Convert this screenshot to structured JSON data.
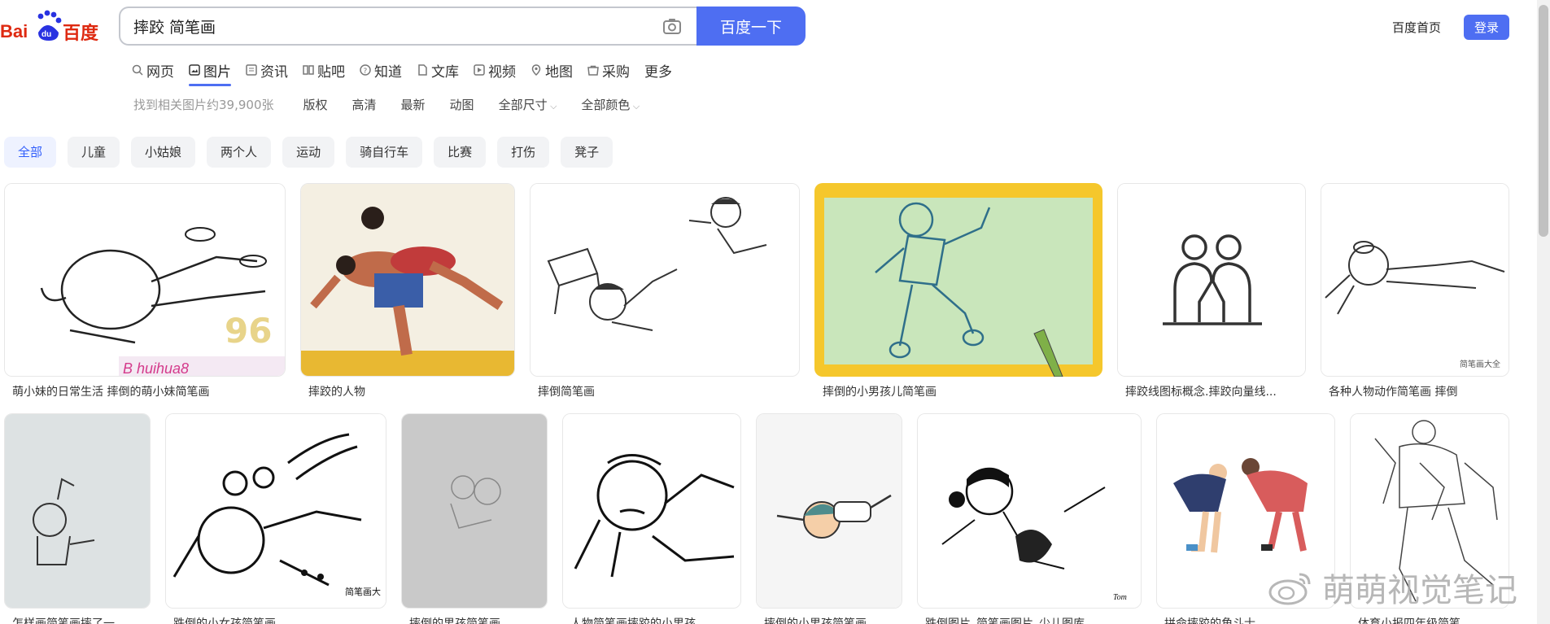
{
  "header": {
    "logo_text": "Bai du 百度",
    "search_value": "摔跤 简笔画",
    "search_button": "百度一下",
    "home_link": "百度首页",
    "login_button": "登录"
  },
  "tabs": [
    {
      "label": "网页",
      "icon": "search-icon"
    },
    {
      "label": "图片",
      "icon": "image-icon",
      "active": true
    },
    {
      "label": "资讯",
      "icon": "news-icon"
    },
    {
      "label": "贴吧",
      "icon": "tieba-icon"
    },
    {
      "label": "知道",
      "icon": "question-icon"
    },
    {
      "label": "文库",
      "icon": "doc-icon"
    },
    {
      "label": "视频",
      "icon": "video-icon"
    },
    {
      "label": "地图",
      "icon": "map-icon"
    },
    {
      "label": "采购",
      "icon": "shop-icon"
    },
    {
      "label": "更多",
      "icon": ""
    }
  ],
  "filters": {
    "result_count": "找到相关图片约39,900张",
    "items": [
      "版权",
      "高清",
      "最新",
      "动图",
      "全部尺寸",
      "全部颜色"
    ]
  },
  "chips": [
    "全部",
    "儿童",
    "小姑娘",
    "两个人",
    "运动",
    "骑自行车",
    "比赛",
    "打伤",
    "凳子"
  ],
  "row1": [
    {
      "caption": "萌小妹的日常生活 摔倒的萌小妹简笔画"
    },
    {
      "caption": "摔跤的人物"
    },
    {
      "caption": "摔倒简笔画"
    },
    {
      "caption": "摔倒的小男孩儿简笔画"
    },
    {
      "caption": "摔跤线图标概念.摔跤向量线..."
    },
    {
      "caption": "各种人物动作简笔画 摔倒"
    }
  ],
  "row2": [
    {
      "caption": "怎样画简笔画摔了一..."
    },
    {
      "caption": "跌倒的小女孩简笔画"
    },
    {
      "caption": "摔倒的男孩简笔画"
    },
    {
      "caption": "人物简笔画摔跤的小男孩..."
    },
    {
      "caption": "摔倒的小男孩简笔画"
    },
    {
      "caption": "跌倒图片_简笔画图片_少儿图库"
    },
    {
      "caption": "拼命摔跤的角斗士..."
    },
    {
      "caption": "体育小报四年级简笔..."
    }
  ],
  "thumb_marks": {
    "hua_96": "96",
    "jianbihua_daquan": "简笔画大全",
    "jianbihua_da": "简笔画大",
    "tom": "Tom"
  },
  "watermark": "萌萌视觉笔记",
  "colors": {
    "accent": "#4e6ef2",
    "chip_active_text": "#315efb",
    "baidu_red": "#de2910",
    "baidu_blue": "#2932e1"
  }
}
